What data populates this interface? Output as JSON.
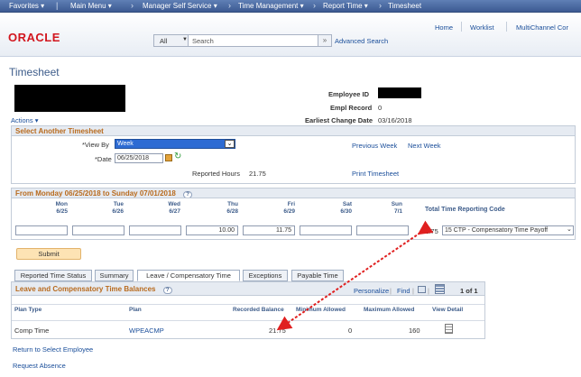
{
  "nav": {
    "items": [
      "Favorites",
      "Main Menu",
      "Manager Self Service",
      "Time Management",
      "Report Time",
      "Timesheet"
    ]
  },
  "header": {
    "logo": "ORACLE",
    "links": [
      "Home",
      "Worklist",
      "MultiChannel Cor"
    ],
    "search_scope": "All",
    "search_placeholder": "Search",
    "advanced_search": "Advanced Search"
  },
  "page": {
    "title": "Timesheet",
    "actions": "Actions"
  },
  "employee": {
    "id_label": "Employee ID",
    "record_label": "Empl Record",
    "record_value": "0",
    "change_label": "Earliest Change Date",
    "change_value": "03/16/2018"
  },
  "select": {
    "header": "Select Another Timesheet",
    "viewby_label": "*View By",
    "viewby_value": "Week",
    "date_label": "*Date",
    "date_value": "06/25/2018",
    "prev_week": "Previous Week",
    "next_week": "Next Week",
    "reported_label": "Reported Hours",
    "reported_value": "21.75",
    "print": "Print Timesheet"
  },
  "week": {
    "header": "From Monday 06/25/2018 to Sunday 07/01/2018",
    "days": [
      {
        "d": "Mon",
        "dt": "6/25",
        "v": ""
      },
      {
        "d": "Tue",
        "dt": "6/26",
        "v": ""
      },
      {
        "d": "Wed",
        "dt": "6/27",
        "v": ""
      },
      {
        "d": "Thu",
        "dt": "6/28",
        "v": "10.00"
      },
      {
        "d": "Fri",
        "dt": "6/29",
        "v": "11.75"
      },
      {
        "d": "Sat",
        "dt": "6/30",
        "v": ""
      },
      {
        "d": "Sun",
        "dt": "7/1",
        "v": ""
      }
    ],
    "total_label": "Total",
    "trc_label": "Time Reporting Code",
    "total_value": "21.75",
    "trc_value": "15 CTP - Compensatory Time Payoff"
  },
  "submit": "Submit",
  "tabs": [
    "Reported Time Status",
    "Summary",
    "Leave / Compensatory Time",
    "Exceptions",
    "Payable Time"
  ],
  "balances": {
    "header": "Leave and Compensatory Time Balances",
    "personalize": "Personalize",
    "find": "Find",
    "pager": "1 of 1",
    "columns": [
      "Plan Type",
      "Plan",
      "Recorded Balance",
      "Minimum Allowed",
      "Maximum Allowed",
      "View Detail"
    ],
    "rows": [
      {
        "type": "Comp Time",
        "plan": "WPEACMP",
        "recorded": "21.75",
        "min": "0",
        "max": "160"
      }
    ]
  },
  "footer": {
    "return": "Return to Select Employee",
    "request": "Request Absence"
  },
  "colors": {
    "nav": "#3c5a92",
    "accent": "#b86a1d",
    "link": "#1a4e9a",
    "arrow": "#e02020"
  }
}
